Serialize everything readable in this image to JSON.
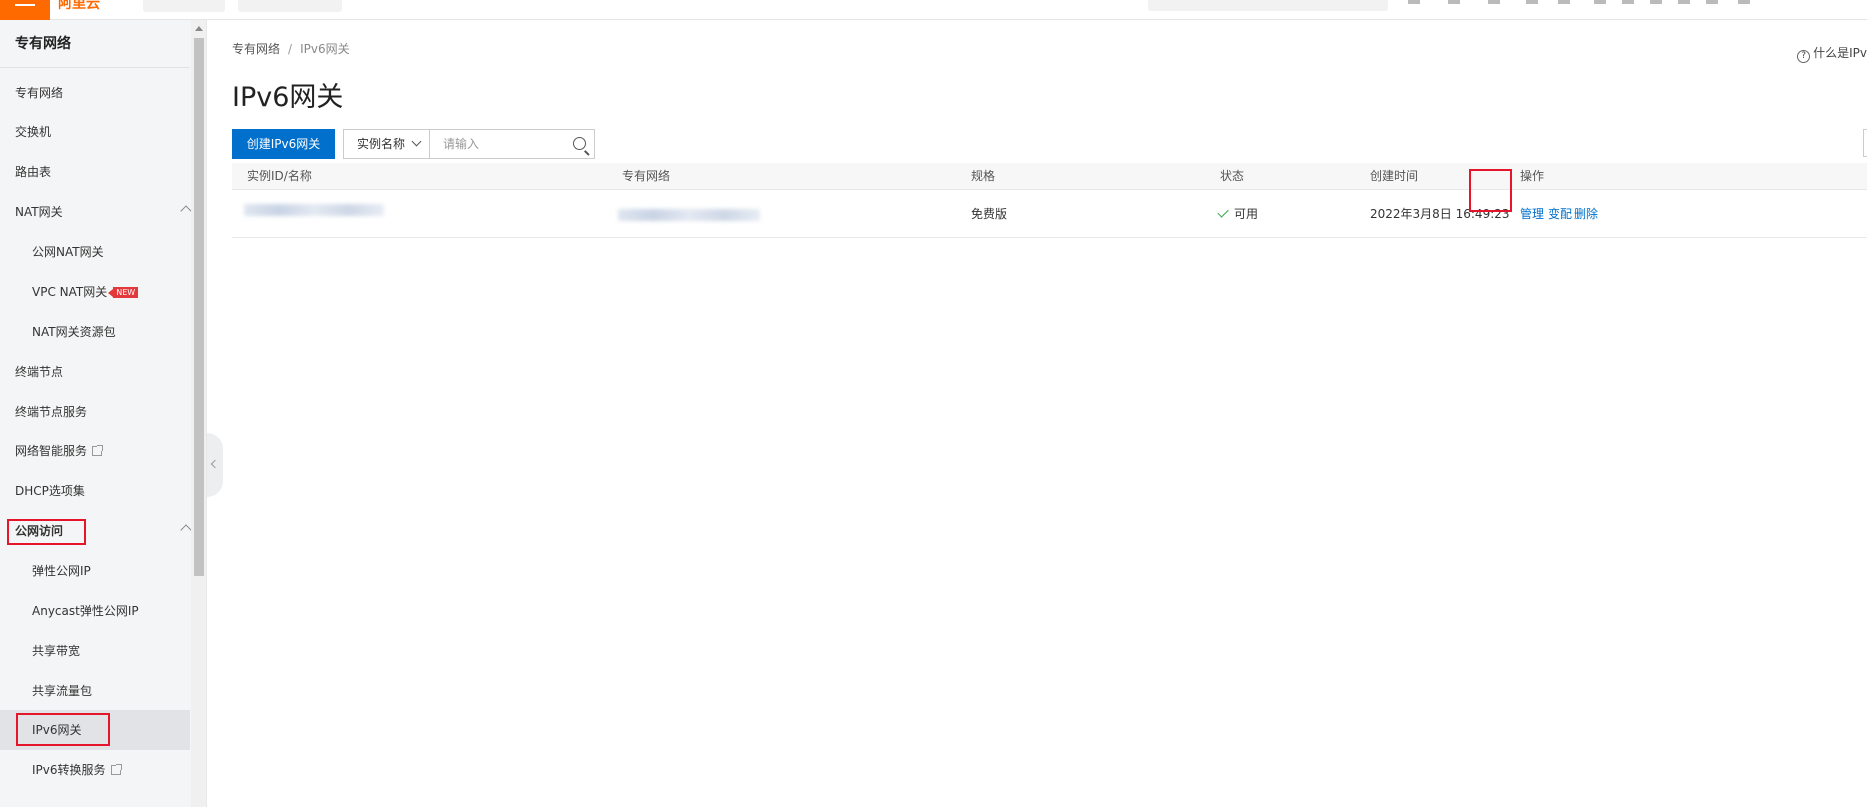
{
  "topbar": {
    "logo": "阿里云"
  },
  "sidebar": {
    "title": "专有网络",
    "items": [
      {
        "label": "专有网络"
      },
      {
        "label": "交换机"
      },
      {
        "label": "路由表"
      },
      {
        "label": "NAT网关"
      },
      {
        "label": "公网NAT网关"
      },
      {
        "label": "VPC NAT网关",
        "badge": "NEW"
      },
      {
        "label": "NAT网关资源包"
      },
      {
        "label": "终端节点"
      },
      {
        "label": "终端节点服务"
      },
      {
        "label": "网络智能服务"
      },
      {
        "label": "DHCP选项集"
      },
      {
        "label": "公网访问"
      },
      {
        "label": "弹性公网IP"
      },
      {
        "label": "Anycast弹性公网IP"
      },
      {
        "label": "共享带宽"
      },
      {
        "label": "共享流量包"
      },
      {
        "label": "IPv6网关"
      },
      {
        "label": "IPv6转换服务"
      }
    ]
  },
  "breadcrumb": {
    "parent": "专有网络",
    "separator": "/",
    "current": "IPv6网关"
  },
  "help": {
    "icon": "?",
    "label": "什么是IPv"
  },
  "page_title": "IPv6网关",
  "toolbar": {
    "create_label": "创建IPv6网关",
    "filter_selected": "实例名称",
    "search_placeholder": "请输入"
  },
  "table": {
    "columns": [
      "实例ID/名称",
      "专有网络",
      "规格",
      "状态",
      "创建时间",
      "操作"
    ],
    "rows": [
      {
        "spec": "免费版",
        "status": "可用",
        "created": "2022年3月8日 16:49:23",
        "actions": [
          "管理",
          "变配",
          "删除"
        ]
      }
    ]
  },
  "colors": {
    "primary": "#0070cc",
    "brand": "#ff6a00",
    "highlight": "#e5162c",
    "success": "#2aa840"
  }
}
